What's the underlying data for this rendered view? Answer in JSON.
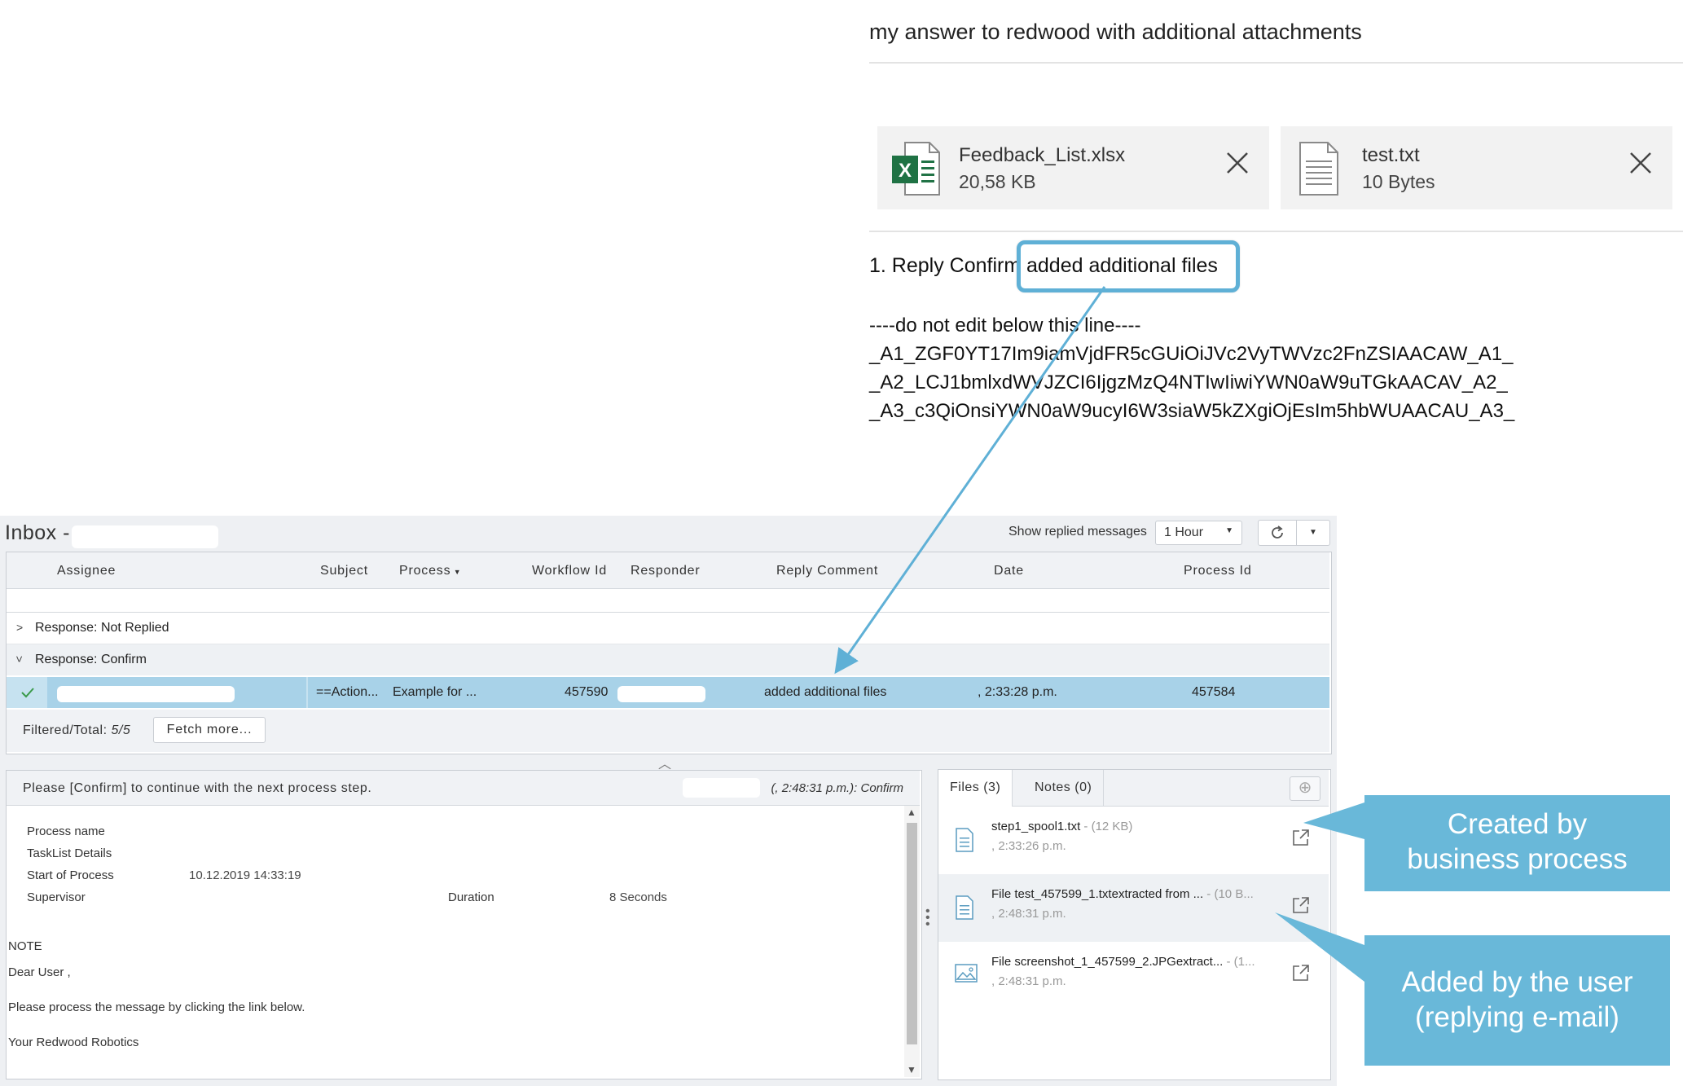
{
  "email": {
    "subject": "my answer to redwood with additional attachments",
    "attachments": [
      {
        "name": "Feedback_List.xlsx",
        "size": "20,58 KB",
        "icon": "excel-file-icon"
      },
      {
        "name": "test.txt",
        "size": "10 Bytes",
        "icon": "text-file-icon"
      }
    ],
    "reply_prefix": "1. Reply Confirm",
    "reply_comment": "added additional files",
    "code_lines": [
      "----do not edit below this line----",
      "_A1_ZGF0YT17Im9iamVjdFR5cGUiOiJVc2VyTWVzc2FnZSIAACAW_A1_",
      "_A2_LCJ1bmlxdWVJZCI6IjgzMzQ4NTIwIiwiYWN0aW9uTGkAACAV_A2_",
      "_A3_c3QiOnsiYWN0aW9ucyI6W3siaW5kZXgiOjEsIm5hbWUAACAU_A3_"
    ]
  },
  "inbox": {
    "title": "Inbox -",
    "show_replied_label": "Show replied messages",
    "show_replied_value": "1 Hour",
    "columns": [
      "Assignee",
      "Subject",
      "Process",
      "Workflow Id",
      "Responder",
      "Reply Comment",
      "Date",
      "Process Id"
    ],
    "groups": [
      {
        "label": "Response: Not Replied",
        "expanded": false
      },
      {
        "label": "Response: Confirm",
        "expanded": true
      }
    ],
    "row": {
      "subject": "==Action...",
      "process": "Example for ...",
      "workflow_id": "457590",
      "reply_comment": "added additional files",
      "date": ", 2:33:28 p.m.",
      "process_id": "457584"
    },
    "footer_label": "Filtered/Total:",
    "footer_count": "5/5",
    "fetch_more": "Fetch more..."
  },
  "detail": {
    "message": "Please [Confirm] to continue with the next process step.",
    "meta": "(, 2:48:31 p.m.): Confirm",
    "fields": {
      "process_name_label": "Process name",
      "tasklist_label": "TaskList Details",
      "start_label": "Start of Process",
      "start_value": "10.12.2019 14:33:19",
      "supervisor_label": "Supervisor",
      "duration_label": "Duration",
      "duration_value": "8 Seconds"
    },
    "note_label": "NOTE",
    "greeting": "Dear User ,",
    "body": "Please process the message by clicking the link below.",
    "signature": "Your Redwood Robotics"
  },
  "files_panel": {
    "tab_files": "Files (3)",
    "tab_notes": "Notes (0)",
    "add_icon": "plus-circle-icon",
    "items": [
      {
        "name": "step1_spool1.txt",
        "size": " - (12 KB)",
        "time": ", 2:33:26 p.m.",
        "icon": "text-file-icon"
      },
      {
        "name": "File test_457599_1.txtextracted from ...",
        "size": " - (10 B...",
        "time": ", 2:48:31 p.m.",
        "icon": "text-file-icon"
      },
      {
        "name": "File screenshot_1_457599_2.JPGextract...",
        "size": " - (1...",
        "time": ", 2:48:31 p.m.",
        "icon": "image-file-icon"
      }
    ]
  },
  "annotations": {
    "callout1": "Created by business process",
    "callout2": "Added by the user (replying e-mail)",
    "accent": "#69b8d9"
  }
}
